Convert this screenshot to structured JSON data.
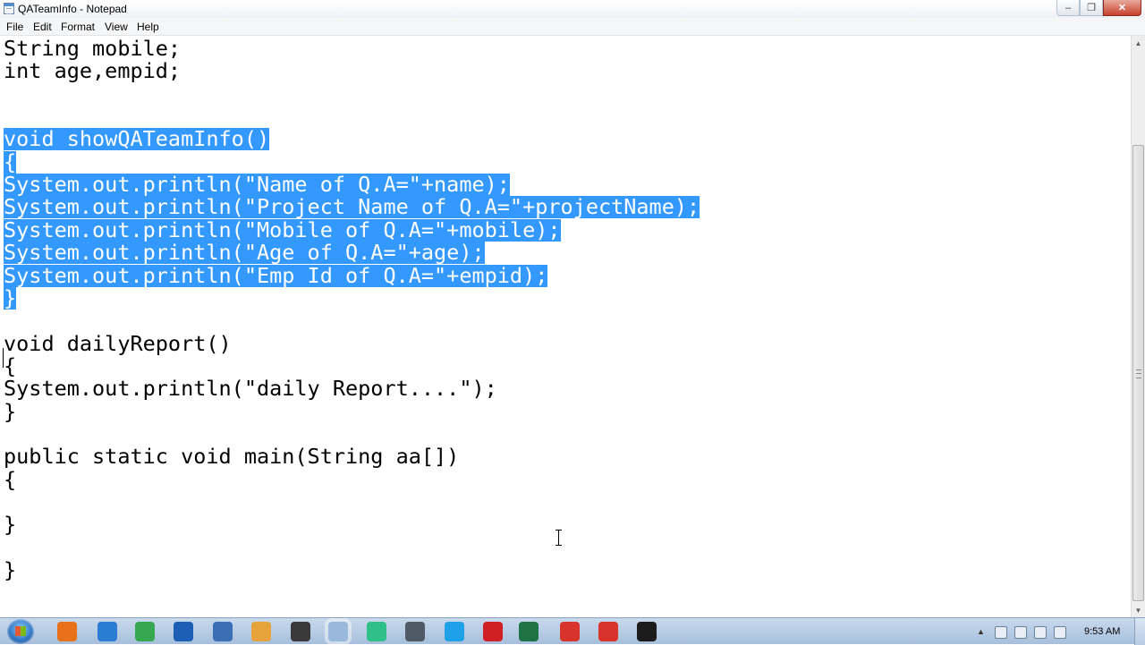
{
  "window": {
    "title": "QATeamInfo - Notepad",
    "controls": {
      "minimize": "–",
      "maximize": "❐",
      "close": "✕"
    }
  },
  "menu": [
    "File",
    "Edit",
    "Format",
    "View",
    "Help"
  ],
  "editor": {
    "selection_color": "#3399ff",
    "lines": [
      {
        "text": "String mobile;",
        "selected": false
      },
      {
        "text": "int age,empid;",
        "selected": false
      },
      {
        "text": "",
        "selected": false
      },
      {
        "text": "",
        "selected": false
      },
      {
        "text": "void showQATeamInfo()",
        "selected": true
      },
      {
        "text": "{",
        "selected": true
      },
      {
        "text": "System.out.println(\"Name of Q.A=\"+name);",
        "selected": true
      },
      {
        "text": "System.out.println(\"Project Name of Q.A=\"+projectName);",
        "selected": true
      },
      {
        "text": "System.out.println(\"Mobile of Q.A=\"+mobile);",
        "selected": true
      },
      {
        "text": "System.out.println(\"Age of Q.A=\"+age);",
        "selected": true
      },
      {
        "text": "System.out.println(\"Emp Id of Q.A=\"+empid);",
        "selected": true
      },
      {
        "text": "}",
        "selected": true
      },
      {
        "text": "",
        "selected": false
      },
      {
        "text": "void dailyReport()",
        "selected": false
      },
      {
        "text": "{",
        "selected": false
      },
      {
        "text": "System.out.println(\"daily Report....\");",
        "selected": false
      },
      {
        "text": "}",
        "selected": false
      },
      {
        "text": "",
        "selected": false
      },
      {
        "text": "public static void main(String aa[])",
        "selected": false
      },
      {
        "text": "{",
        "selected": false
      },
      {
        "text": "",
        "selected": false
      },
      {
        "text": "}",
        "selected": false
      },
      {
        "text": "",
        "selected": false
      },
      {
        "text": "}",
        "selected": false
      }
    ]
  },
  "scrollbar": {
    "up": "▲",
    "down": "▼"
  },
  "taskbar": {
    "apps": [
      {
        "name": "firefox-icon",
        "color": "#e8711c"
      },
      {
        "name": "ie-icon",
        "color": "#2b7cd3"
      },
      {
        "name": "chrome-icon",
        "color": "#36a852"
      },
      {
        "name": "outlook-icon",
        "color": "#1d5fb4"
      },
      {
        "name": "shield-icon",
        "color": "#3a6fb5"
      },
      {
        "name": "media-icon",
        "color": "#e6a33b"
      },
      {
        "name": "disc-icon",
        "color": "#3a3a3a"
      },
      {
        "name": "notepad-icon",
        "color": "#9ab8dc"
      },
      {
        "name": "screen-icon",
        "color": "#2fc08a"
      },
      {
        "name": "settings-icon",
        "color": "#505a66"
      },
      {
        "name": "skype-icon",
        "color": "#1ea1e8"
      },
      {
        "name": "opera-icon",
        "color": "#d11f26"
      },
      {
        "name": "excel-icon",
        "color": "#1f7244"
      },
      {
        "name": "recorder-icon",
        "color": "#d9342b"
      },
      {
        "name": "recorder2-icon",
        "color": "#d9342b"
      },
      {
        "name": "cmd-icon",
        "color": "#1c1c1c"
      }
    ],
    "clock": "9:53 AM"
  }
}
